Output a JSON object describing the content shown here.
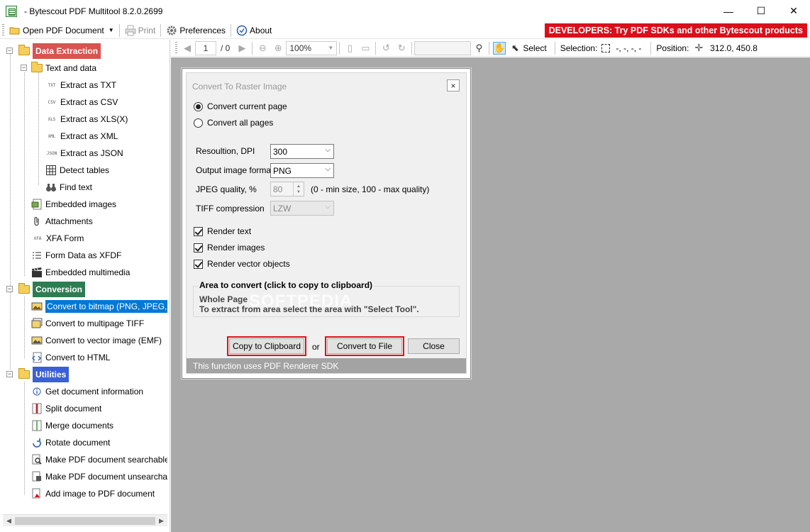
{
  "window": {
    "title": "- Bytescout PDF Multitool 8.2.0.2699",
    "controls": {
      "minimize": "—",
      "maximize": "☐",
      "close": "✕"
    }
  },
  "toolbar": {
    "open_label": "Open PDF Document",
    "print_label": "Print",
    "preferences_label": "Preferences",
    "about_label": "About",
    "banner": "DEVELOPERS: Try PDF SDKs and other Bytescout products"
  },
  "tree": {
    "cat_data_extraction": "Data Extraction",
    "text_and_data": "Text and data",
    "extract_txt": "Extract as TXT",
    "extract_csv": "Extract as CSV",
    "extract_xls": "Extract as XLS(X)",
    "extract_xml": "Extract as XML",
    "extract_json": "Extract as JSON",
    "detect_tables": "Detect tables",
    "find_text": "Find text",
    "embedded_images": "Embedded images",
    "attachments": "Attachments",
    "xfa_form": "XFA Form",
    "form_data_xfdf": "Form Data as XFDF",
    "embedded_multimedia": "Embedded multimedia",
    "cat_conversion": "Conversion",
    "convert_bitmap": "Convert to bitmap (PNG, JPEG, ...)",
    "convert_tiff": "Convert to multipage TIFF",
    "convert_vector": "Convert to vector image (EMF)",
    "convert_html": "Convert to HTML",
    "cat_utilities": "Utilities",
    "get_doc_info": "Get document information",
    "split_doc": "Split document",
    "merge_docs": "Merge documents",
    "rotate_doc": "Rotate document",
    "make_searchable": "Make PDF document searchable",
    "make_unsearchable": "Make PDF document unsearchable",
    "add_image": "Add image to PDF document",
    "icon_labels": {
      "txt": "TXT",
      "csv": "CSV",
      "xls": "XLS",
      "xml": "XML",
      "json": "JSON",
      "xfa": "XFA"
    },
    "colors": {
      "data_extraction": "#d9534f",
      "conversion": "#2e7d52",
      "utilities": "#3b5fd6",
      "selection": "#0078d7"
    }
  },
  "viewer_toolbar": {
    "page_value": "1",
    "page_total": "/ 0",
    "zoom_value": "100%",
    "select_label": "Select",
    "selection_label": "Selection:",
    "selection_value": "-, -, -, -",
    "position_label": "Position:",
    "position_value": "312.0, 450.8"
  },
  "dialog": {
    "title": "Convert To Raster Image",
    "close_glyph": "×",
    "convert_current_page": "Convert current page",
    "convert_all_pages": "Convert all pages",
    "resolution_label": "Resoultion, DPI",
    "resolution_value": "300",
    "format_label": "Output image format",
    "format_value": "PNG",
    "jpeg_label": "JPEG quality, %",
    "jpeg_value": "80",
    "jpeg_hint": "(0 - min size, 100 - max quality)",
    "tiff_label": "TIFF compression",
    "tiff_value": "LZW",
    "render_text": "Render text",
    "render_images": "Render images",
    "render_vector": "Render vector objects",
    "area_title": "Area to convert (click to copy to clipboard)",
    "area_line1": "Whole Page",
    "area_line2": "To extract from area select the area with \"Select Tool\".",
    "copy_btn": "Copy to Clipboard",
    "or_label": "or",
    "convert_btn": "Convert to File",
    "close_btn": "Close",
    "footer": "This function uses PDF Renderer SDK",
    "watermark": "SOFTPEDIA"
  }
}
